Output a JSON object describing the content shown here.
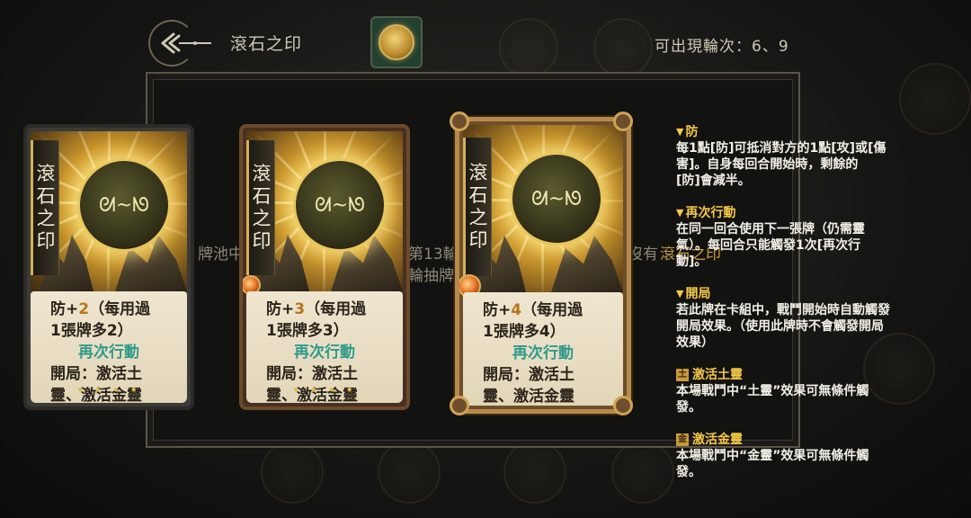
{
  "header": {
    "title": "滾石之印",
    "rounds_label": "可出現輪次：6、9"
  },
  "background_text": {
    "left": "牌池中",
    "middle": "第13輪",
    "middle2": "輪抽牌",
    "right_prefix": "沒有",
    "right_highlight": "滾石之印"
  },
  "cards": [
    {
      "name": "滾石之印",
      "name_chars": [
        "滾",
        "石",
        "之",
        "印"
      ],
      "line1_prefix": "防+",
      "line1_num": "2",
      "line1_suffix": "（每用過",
      "line2": "1張牌多2）",
      "keyword": "再次行動",
      "line4": "開局：激活土",
      "line5": "靈、激活金靈",
      "dots": "• • • •"
    },
    {
      "name": "滾石之印",
      "name_chars": [
        "滾",
        "石",
        "之",
        "印"
      ],
      "line1_prefix": "防+",
      "line1_num": "3",
      "line1_suffix": "（每用過",
      "line2": "1張牌多3）",
      "keyword": "再次行動",
      "line4": "開局：激活土",
      "line5": "靈、激活金靈",
      "dots": "• • • •"
    },
    {
      "name": "滾石之印",
      "name_chars": [
        "滾",
        "石",
        "之",
        "印"
      ],
      "line1_prefix": "防+",
      "line1_num": "4",
      "line1_suffix": "（每用過",
      "line2": "1張牌多4）",
      "keyword": "再次行動",
      "line4": "開局：激活土",
      "line5": "靈、激活金靈",
      "dots": ""
    }
  ],
  "info": [
    {
      "title": "防",
      "lines": [
        "每1點[防]可抵消對方的1點[攻]或[傷",
        "害]。自身每回合開始時，剩餘的",
        "[防]會減半。"
      ]
    },
    {
      "title": "再次行動",
      "lines": [
        "在同一回合使用下一張牌（仍需靈",
        "氣）。每回合只能觸發1次[再次行",
        "動]。"
      ]
    },
    {
      "title": "開局",
      "lines": [
        "若此牌在卡組中，戰鬥開始時自動觸發",
        "開局效果。（使用此牌時不會觸發開局",
        "效果）"
      ]
    },
    {
      "title": "激活土靈",
      "icon": "土",
      "lines": [
        "本場戰鬥中“土靈”效果可無條件觸",
        "發。"
      ]
    },
    {
      "title": "激活金靈",
      "icon": "金",
      "lines": [
        "本場戰鬥中“金靈”效果可無條件觸",
        "發。"
      ]
    }
  ],
  "colors": {
    "accent_gold": "#f5c84a",
    "number_orange": "#b8751e",
    "keyword_teal": "#2f9a8a"
  }
}
